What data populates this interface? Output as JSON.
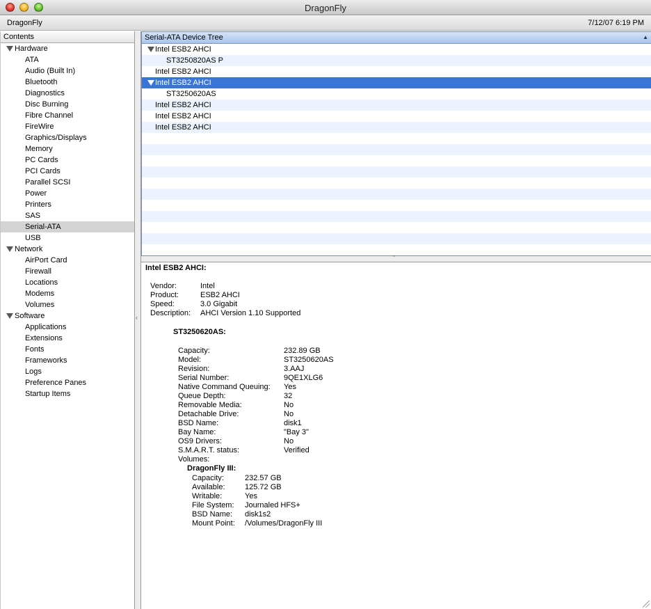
{
  "window": {
    "title": "DragonFly"
  },
  "infobar": {
    "machine_name": "DragonFly",
    "datetime": "7/12/07 6:19 PM"
  },
  "sidebar": {
    "header": "Contents",
    "groups": [
      {
        "label": "Hardware",
        "items": [
          "ATA",
          "Audio (Built In)",
          "Bluetooth",
          "Diagnostics",
          "Disc Burning",
          "Fibre Channel",
          "FireWire",
          "Graphics/Displays",
          "Memory",
          "PC Cards",
          "PCI Cards",
          "Parallel SCSI",
          "Power",
          "Printers",
          "SAS",
          "Serial-ATA",
          "USB"
        ]
      },
      {
        "label": "Network",
        "items": [
          "AirPort Card",
          "Firewall",
          "Locations",
          "Modems",
          "Volumes"
        ]
      },
      {
        "label": "Software",
        "items": [
          "Applications",
          "Extensions",
          "Fonts",
          "Frameworks",
          "Logs",
          "Preference Panes",
          "Startup Items"
        ]
      }
    ],
    "selected_item": "Serial-ATA"
  },
  "device_tree": {
    "header": "Serial-ATA Device Tree",
    "rows": [
      {
        "label": "Intel ESB2 AHCI",
        "level": 0,
        "expanded": true,
        "selected": false
      },
      {
        "label": "ST3250820AS P",
        "level": 1,
        "selected": false
      },
      {
        "label": "Intel ESB2 AHCI",
        "level": 0,
        "selected": false
      },
      {
        "label": "Intel ESB2 AHCI",
        "level": 0,
        "expanded": true,
        "selected": true
      },
      {
        "label": "ST3250620AS",
        "level": 1,
        "selected": false
      },
      {
        "label": "Intel ESB2 AHCI",
        "level": 0,
        "selected": false
      },
      {
        "label": "Intel ESB2 AHCI",
        "level": 0,
        "selected": false
      },
      {
        "label": "Intel ESB2 AHCI",
        "level": 0,
        "selected": false
      }
    ],
    "empty_rows": 11
  },
  "detail": {
    "title": "Intel ESB2 AHCI:",
    "controller": [
      {
        "k": "Vendor:",
        "v": "Intel"
      },
      {
        "k": "Product:",
        "v": "ESB2 AHCI"
      },
      {
        "k": "Speed:",
        "v": "3.0 Gigabit"
      },
      {
        "k": "Description:",
        "v": "AHCI Version 1.10 Supported"
      }
    ],
    "drive_title": "ST3250620AS:",
    "drive": [
      {
        "k": "Capacity:",
        "v": "232.89 GB"
      },
      {
        "k": "Model:",
        "v": "ST3250620AS"
      },
      {
        "k": "Revision:",
        "v": "3.AAJ"
      },
      {
        "k": "Serial Number:",
        "v": "9QE1XLG6"
      },
      {
        "k": "Native Command Queuing:",
        "v": "Yes"
      },
      {
        "k": "Queue Depth:",
        "v": "32"
      },
      {
        "k": "Removable Media:",
        "v": "No"
      },
      {
        "k": "Detachable Drive:",
        "v": "No"
      },
      {
        "k": "BSD Name:",
        "v": "disk1"
      },
      {
        "k": "Bay Name:",
        "v": "\"Bay 3\""
      },
      {
        "k": "OS9 Drivers:",
        "v": "No"
      },
      {
        "k": "S.M.A.R.T. status:",
        "v": "Verified"
      },
      {
        "k": "Volumes:",
        "v": ""
      }
    ],
    "volume_title": "DragonFly III:",
    "volume": [
      {
        "k": "Capacity:",
        "v": "232.57 GB"
      },
      {
        "k": "Available:",
        "v": "125.72 GB"
      },
      {
        "k": "Writable:",
        "v": "Yes"
      },
      {
        "k": "File System:",
        "v": "Journaled HFS+"
      },
      {
        "k": "BSD Name:",
        "v": "disk1s2"
      },
      {
        "k": "Mount Point:",
        "v": "/Volumes/DragonFly III"
      }
    ]
  }
}
